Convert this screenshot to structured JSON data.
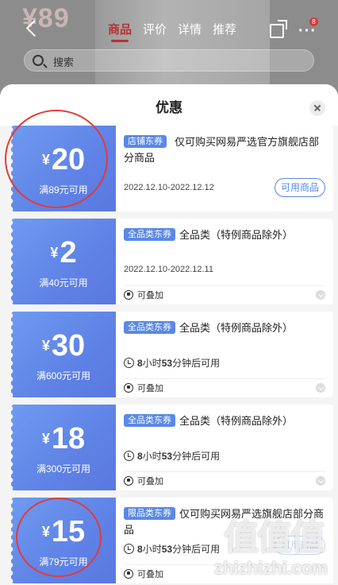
{
  "background": {
    "price": "¥89",
    "tabs": [
      "商品",
      "评价",
      "详情",
      "推荐"
    ],
    "active_tab": "商品",
    "badge_count": "8",
    "search_placeholder": "搜索"
  },
  "sheet": {
    "title": "优惠",
    "coupons": [
      {
        "amount": "20",
        "currency": "¥",
        "condition": "满89元可用",
        "tag": "店铺东券",
        "title": "仅可购买网易严选官方旗舰店部分商品",
        "date": "2022.12.10-2022.12.12",
        "button": "可用商品"
      },
      {
        "amount": "2",
        "currency": "¥",
        "condition": "满40元可用",
        "tag": "全品类东券",
        "title": "全品类（特例商品除外）",
        "date": "2022.12.10-2022.12.11",
        "stack": "可叠加"
      },
      {
        "amount": "30",
        "currency": "¥",
        "condition": "满600元可用",
        "tag": "全品类东券",
        "title": "全品类（特例商品除外）",
        "countdown_hours": "8",
        "countdown_h_unit": "小时",
        "countdown_minutes": "53",
        "countdown_m_unit": "分钟后可用",
        "stack": "可叠加"
      },
      {
        "amount": "18",
        "currency": "¥",
        "condition": "满300元可用",
        "tag": "全品类东券",
        "title": "全品类（特例商品除外）",
        "countdown_hours": "8",
        "countdown_h_unit": "小时",
        "countdown_minutes": "53",
        "countdown_m_unit": "分钟后可用",
        "stack": "可叠加"
      },
      {
        "amount": "15",
        "currency": "¥",
        "condition": "满79元可用",
        "tag": "限品类东券",
        "title": "仅可购买网易严选旗舰店部分商品",
        "countdown_hours": "8",
        "countdown_h_unit": "小时",
        "countdown_minutes": "53",
        "countdown_m_unit": "分钟后可用",
        "stack": "可叠加",
        "button": "可用商品"
      }
    ]
  },
  "watermark": {
    "logo": "值值值",
    "text": "zhizhizhi.com"
  },
  "colors": {
    "coupon_blue": "#5f82e6",
    "tag_blue": "#5a88e6",
    "annotation_red": "#e23b3b",
    "active_tab_red": "#b83232"
  }
}
